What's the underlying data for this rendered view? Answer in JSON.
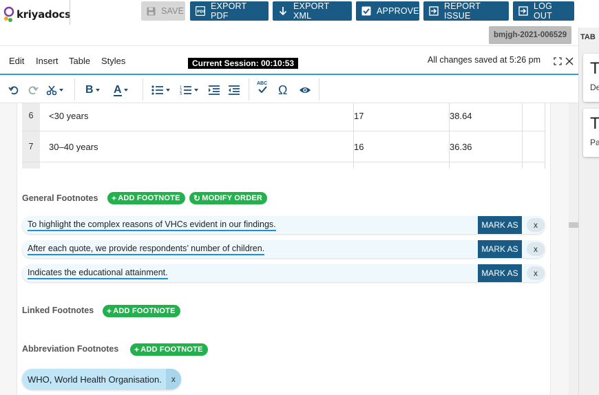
{
  "brand": {
    "name": "kriyadocs"
  },
  "top_actions": {
    "save": "SAVE",
    "export_pdf": "EXPORT PDF",
    "export_xml": "EXPORT XML",
    "approve": "APPROVE",
    "report_issue": "REPORT ISSUE",
    "log_out": "LOG OUT"
  },
  "doc_id": "bmjgh-2021-006529",
  "right_panel": {
    "tab_label": "TAB",
    "cards": [
      {
        "big": "Ta",
        "small": "De"
      },
      {
        "big": "Ta",
        "small": "Pa"
      }
    ]
  },
  "menu": {
    "items": [
      "Edit",
      "Insert",
      "Table",
      "Styles"
    ]
  },
  "session": "Current Session: 00:10:53",
  "save_status": "All changes saved at 5:26 pm",
  "toolbar": {
    "icons": [
      "undo-icon",
      "redo-icon",
      "cut-icon",
      "bold-icon",
      "text-color-icon",
      "bullet-list-icon",
      "numbered-list-icon",
      "indent-icon",
      "outdent-icon",
      "spellcheck-icon",
      "omega-icon",
      "eye-icon"
    ],
    "spell_label": "ABC",
    "omega": "Ω",
    "bold": "B",
    "text_color": "A"
  },
  "table": {
    "rows": [
      {
        "num": "6",
        "label": "<30 years",
        "n": "17",
        "pct": "38.64"
      },
      {
        "num": "7",
        "label": "30–40 years",
        "n": "16",
        "pct": "36.36"
      }
    ]
  },
  "general_footnotes": {
    "label": "General Footnotes",
    "add": "ADD FOOTNOTE",
    "modify": "MODIFY ORDER",
    "items": [
      {
        "text": "To highlight the complex reasons of VHCs evident in our findings.",
        "mark": "MARK AS",
        "x": "x"
      },
      {
        "text": "After each quote, we provide respondents’ number of children.",
        "mark": "MARK AS",
        "x": "x"
      },
      {
        "text": "Indicates the educational attainment.",
        "mark": "MARK AS",
        "x": "x"
      }
    ]
  },
  "linked_footnotes": {
    "label": "Linked Footnotes",
    "add": "ADD FOOTNOTE"
  },
  "abbreviation_footnotes": {
    "label": "Abbreviation Footnotes",
    "add": "ADD FOOTNOTE",
    "items": [
      {
        "text": "WHO, World Health Organisation.",
        "x": "x"
      }
    ]
  },
  "colors": {
    "primary": "#1a5b86",
    "green": "#23b14d",
    "accent_line": "#2a9fd6"
  }
}
